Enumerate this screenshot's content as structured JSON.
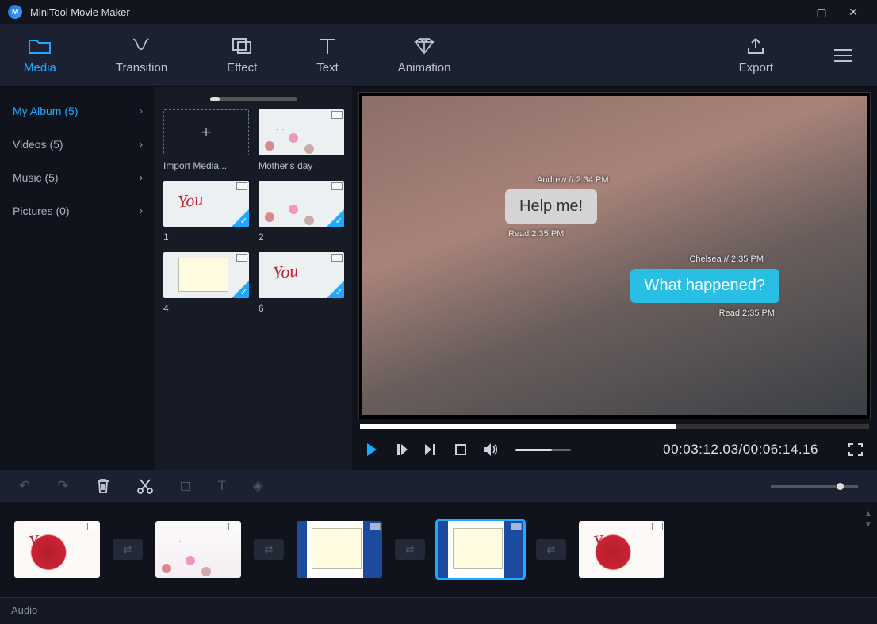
{
  "app_title": "MiniTool Movie Maker",
  "tabs": {
    "media": "Media",
    "transition": "Transition",
    "effect": "Effect",
    "text": "Text",
    "animation": "Animation",
    "export": "Export"
  },
  "sidebar": {
    "items": [
      {
        "label": "My Album (5)",
        "active": true
      },
      {
        "label": "Videos (5)",
        "active": false
      },
      {
        "label": "Music (5)",
        "active": false
      },
      {
        "label": "Pictures (0)",
        "active": false
      }
    ]
  },
  "media": {
    "import_label": "Import Media...",
    "items": [
      {
        "label": "Mother's day",
        "checked": false,
        "art": "flowers"
      },
      {
        "label": "1",
        "checked": true,
        "art": "rose"
      },
      {
        "label": "2",
        "checked": true,
        "art": "flowers"
      },
      {
        "label": "4",
        "checked": true,
        "art": "screen"
      },
      {
        "label": "6",
        "checked": true,
        "art": "rose"
      }
    ]
  },
  "preview": {
    "chat": {
      "m1_meta": "Andrew // 2:34 PM",
      "m1_text": "Help me!",
      "m1_read": "Read 2:35 PM",
      "m2_meta": "Chelsea // 2:35 PM",
      "m2_text": "What happened?",
      "m2_read": "Read 2:35 PM"
    },
    "time_current": "00:03:12.03",
    "time_sep": "/",
    "time_total": "00:06:14.16"
  },
  "audiotrack_label": "Audio"
}
